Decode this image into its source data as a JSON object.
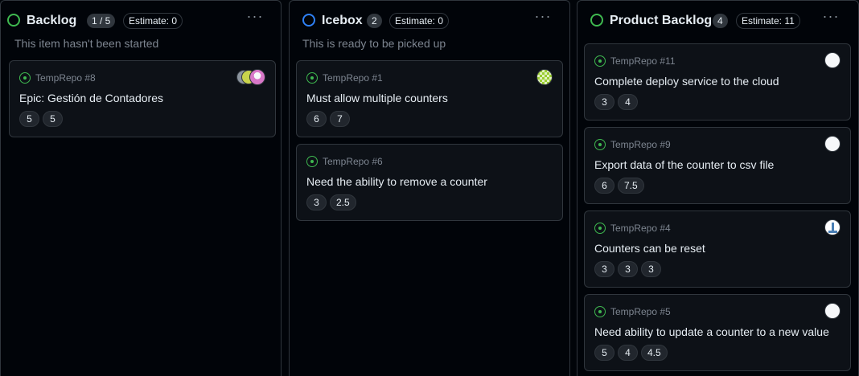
{
  "columns": [
    {
      "title": "Backlog",
      "count": "1 / 5",
      "estimate": "Estimate: 0",
      "description": "This item hasn't been started",
      "status_color": "#3fb950",
      "cards": [
        {
          "repo": "TempRepo #8",
          "title": "Epic: Gestión de Contadores",
          "chips": [
            "5",
            "5"
          ],
          "avatars": [
            "avatar-group-icon"
          ]
        }
      ]
    },
    {
      "title": "Icebox",
      "count": "2",
      "estimate": "Estimate: 0",
      "description": "This is ready to be picked up",
      "status_color": "#2f81f7",
      "cards": [
        {
          "repo": "TempRepo #1",
          "title": "Must allow multiple counters",
          "chips": [
            "6",
            "7"
          ],
          "avatars": [
            "avatar-icon"
          ]
        },
        {
          "repo": "TempRepo #6",
          "title": "Need the ability to remove a counter",
          "chips": [
            "3",
            "2.5"
          ],
          "avatars": []
        }
      ]
    },
    {
      "title": "Product Backlog",
      "count": "4",
      "estimate": "Estimate: 11",
      "description": "",
      "status_color": "#3fb950",
      "cards": [
        {
          "repo": "TempRepo #11",
          "title": "Complete deploy service to the cloud",
          "chips": [
            "3",
            "4"
          ],
          "avatars": [
            "avatar-icon"
          ]
        },
        {
          "repo": "TempRepo #9",
          "title": "Export data of the counter to csv file",
          "chips": [
            "6",
            "7.5"
          ],
          "avatars": [
            "avatar-icon"
          ]
        },
        {
          "repo": "TempRepo #4",
          "title": "Counters can be reset",
          "chips": [
            "3",
            "3",
            "3"
          ],
          "avatars": [
            "avatar-icon"
          ]
        },
        {
          "repo": "TempRepo #5",
          "title": "Need ability to update a counter to a new value",
          "chips": [
            "5",
            "4",
            "4.5"
          ],
          "avatars": [
            "avatar-icon"
          ]
        }
      ]
    }
  ],
  "icons": {
    "more": "kebab-horizontal-icon",
    "issue": "issue-opened-icon",
    "status": "status-circle-icon"
  }
}
